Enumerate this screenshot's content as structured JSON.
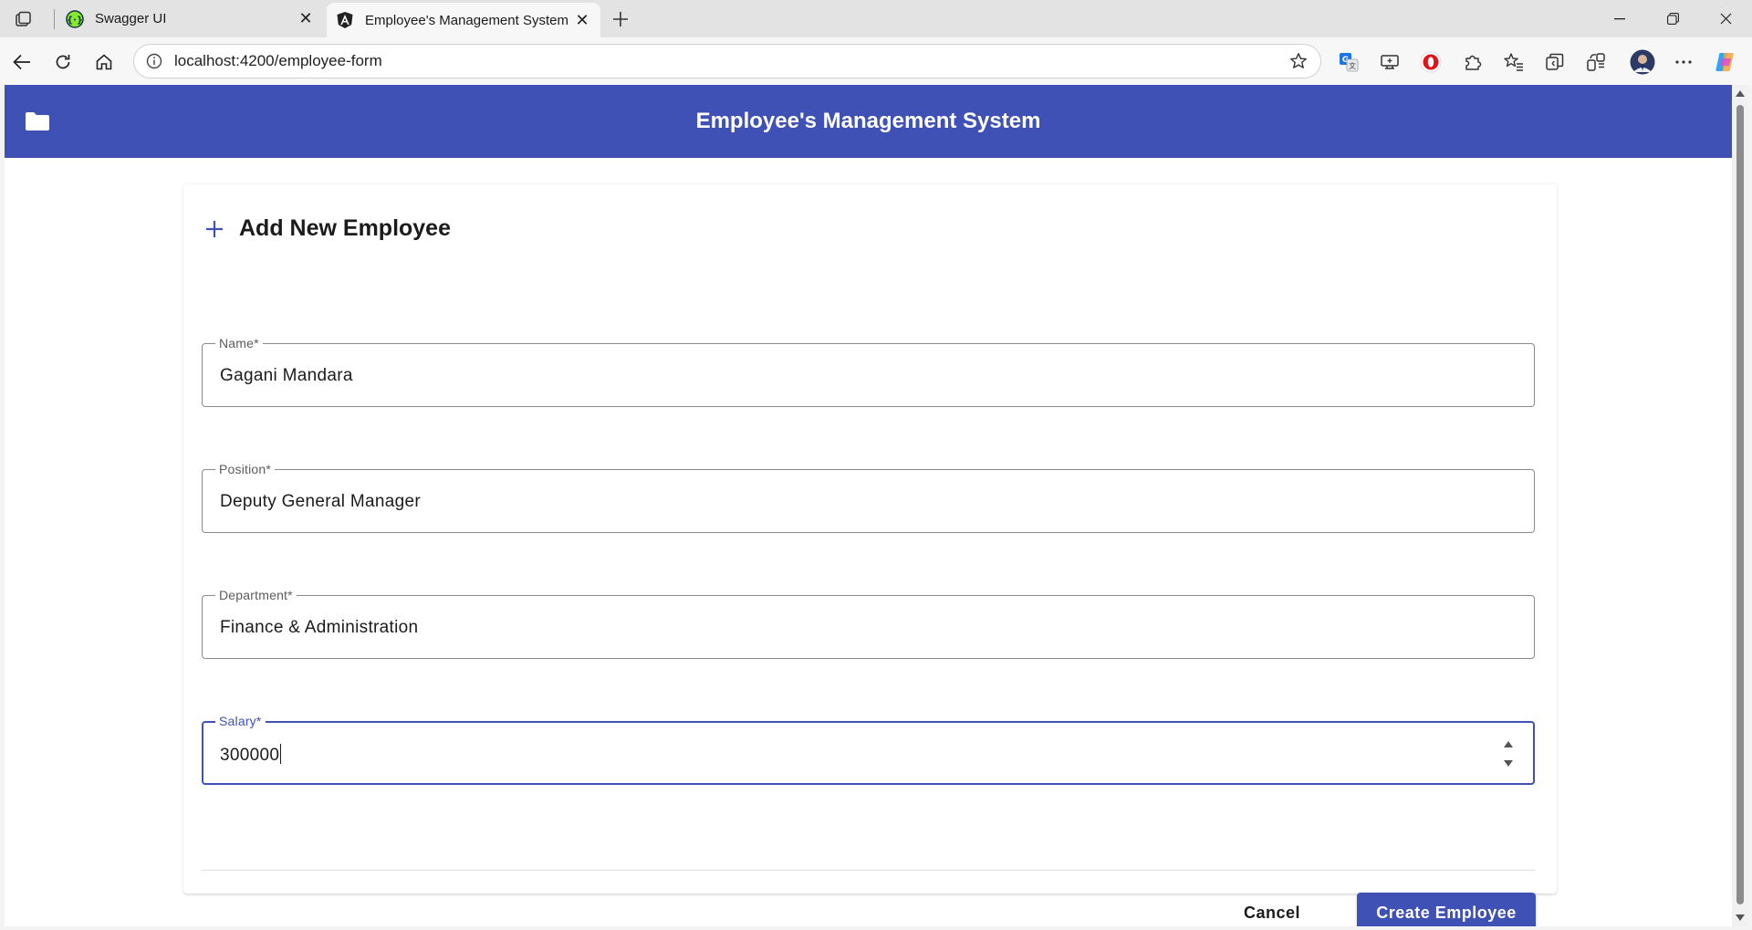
{
  "browser": {
    "tabs": [
      {
        "title": "Swagger UI",
        "favicon": "swagger-icon",
        "active": false
      },
      {
        "title": "Employee's Management System",
        "favicon": "angular-icon",
        "active": true
      }
    ],
    "url": "localhost:4200/employee-form"
  },
  "app": {
    "title": "Employee's Management System",
    "header_color": "#3f51b5"
  },
  "form": {
    "title": "Add New Employee",
    "fields": {
      "name": {
        "label": "Name*",
        "value": "Gagani Mandara"
      },
      "position": {
        "label": "Position*",
        "value": "Deputy General Manager"
      },
      "department": {
        "label": "Department*",
        "value": "Finance & Administration"
      },
      "salary": {
        "label": "Salary*",
        "value": "300000"
      }
    },
    "cancel_label": "Cancel",
    "submit_label": "Create Employee"
  }
}
